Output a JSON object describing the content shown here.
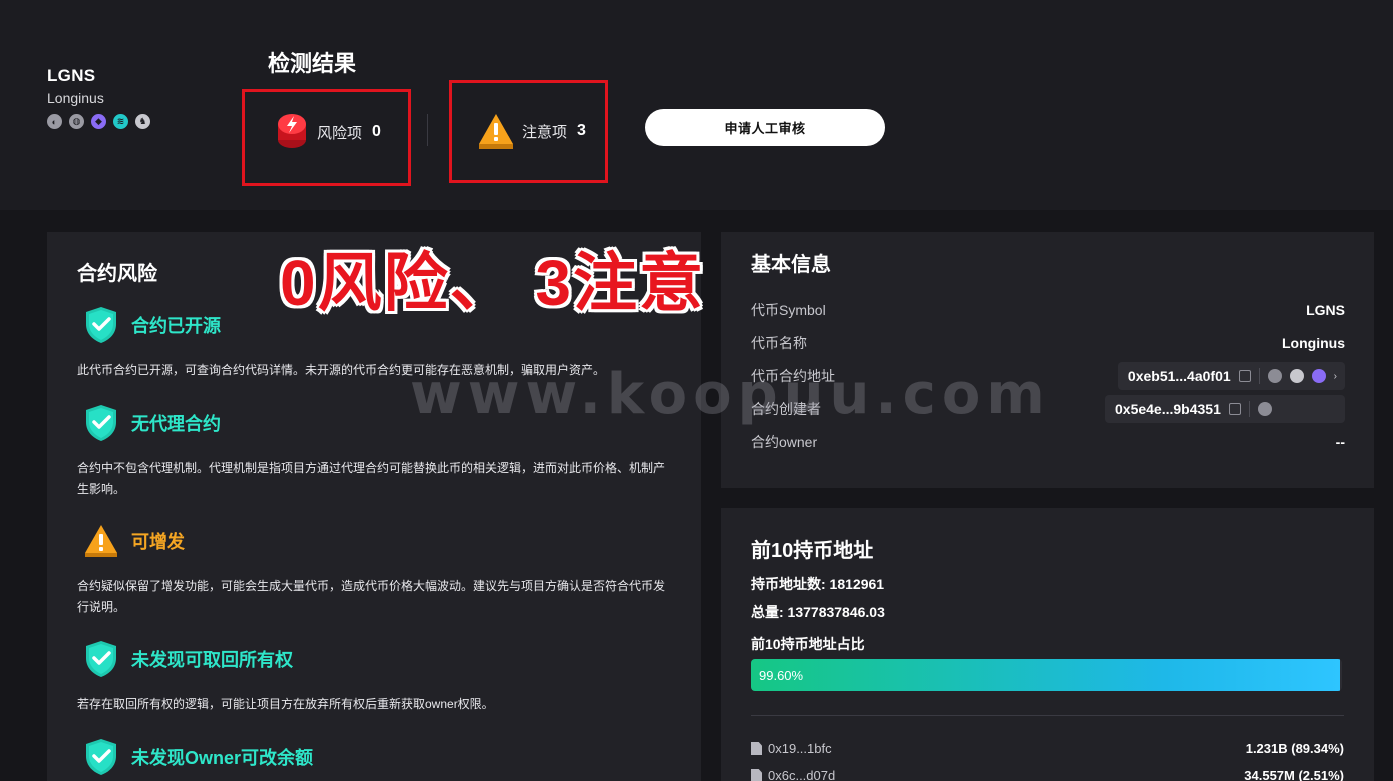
{
  "token": {
    "symbol": "LGNS",
    "name": "Longinus",
    "chain_icons": [
      "chain-icon-1",
      "chain-icon-2",
      "chain-icon-3",
      "chain-icon-4",
      "chain-icon-5"
    ]
  },
  "header": {
    "title": "检测结果",
    "risk_label": "风险项",
    "risk_count": "0",
    "warn_label": "注意项",
    "warn_count": "3",
    "apply_button": "申请人工审核"
  },
  "overlay": {
    "annotation": "0风险、 3注意",
    "watermark": "www.koopuu.com"
  },
  "contract_risk": {
    "title": "合约风险",
    "items": [
      {
        "title": "合约已开源",
        "status": "safe",
        "desc": "此代币合约已开源，可查询合约代码详情。未开源的代币合约更可能存在恶意机制，骗取用户资产。"
      },
      {
        "title": "无代理合约",
        "status": "safe",
        "desc": "合约中不包含代理机制。代理机制是指项目方通过代理合约可能替换此币的相关逻辑，进而对此币价格、机制产生影响。"
      },
      {
        "title": "可增发",
        "status": "warning",
        "desc": "合约疑似保留了增发功能，可能会生成大量代币，造成代币价格大幅波动。建议先与项目方确认是否符合代币发行说明。"
      },
      {
        "title": "未发现可取回所有权",
        "status": "safe",
        "desc": "若存在取回所有权的逻辑，可能让项目方在放弃所有权后重新获取owner权限。"
      },
      {
        "title": "未发现Owner可改余额",
        "status": "safe",
        "desc": ""
      }
    ]
  },
  "basic_info": {
    "title": "基本信息",
    "rows": [
      {
        "label": "代币Symbol",
        "value": "LGNS"
      },
      {
        "label": "代币名称",
        "value": "Longinus"
      },
      {
        "label": "代币合约地址",
        "value": "0xeb51...4a0f01"
      },
      {
        "label": "合约创建者",
        "value": "0x5e4e...9b4351"
      },
      {
        "label": "合约owner",
        "value": "--"
      }
    ]
  },
  "holders": {
    "title": "前10持币地址",
    "count_label": "持币地址数: 1812961",
    "total_label": "总量: 1377837846.03",
    "ratio_title": "前10持币地址占比",
    "ratio_text": "99.60%",
    "ratio_value": 99.6,
    "rows": [
      {
        "address": "0x19...1bfc",
        "amount": "1.231B  (89.34%)"
      },
      {
        "address": "0x6c...d07d",
        "amount": "34.557M  (2.51%)"
      }
    ]
  },
  "colors": {
    "risk_red": "#e8161f",
    "safe_green": "#2ee6c9",
    "warn_orange": "#f5a623"
  }
}
